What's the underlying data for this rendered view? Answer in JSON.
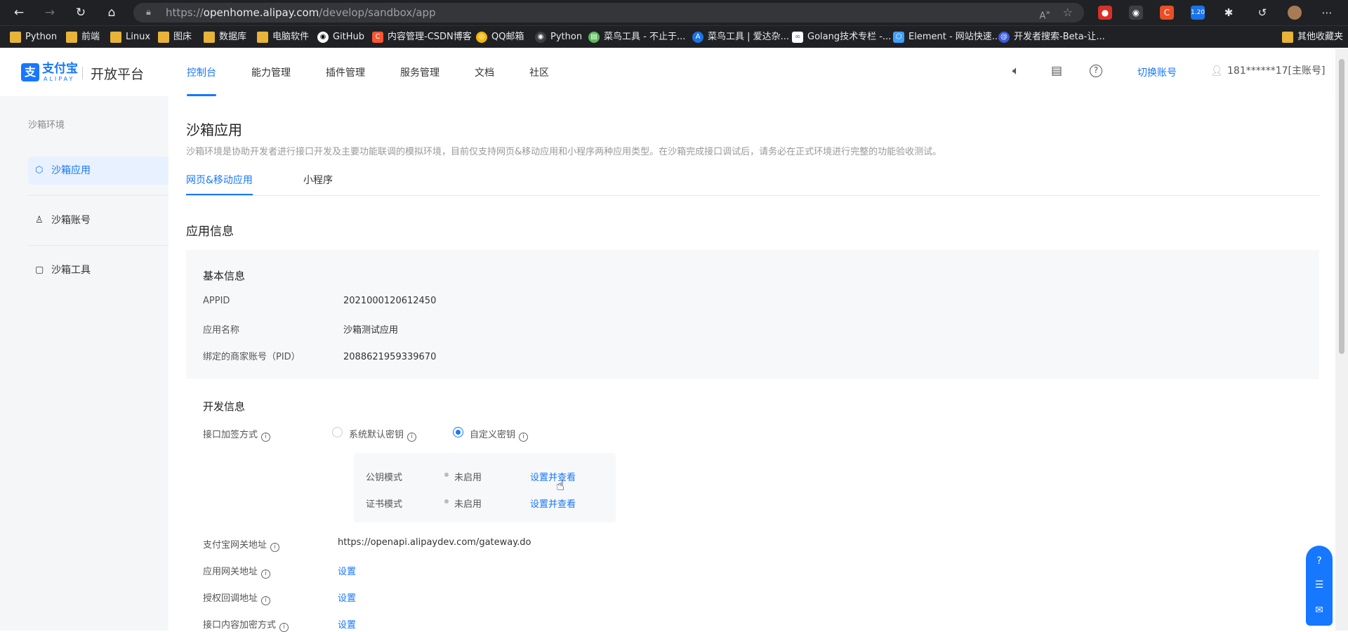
{
  "browser": {
    "url_host": "openhome.alipay.com",
    "url_prefix": "https://",
    "url_path": "/develop/sandbox/app",
    "other_bookmarks": "其他收藏夹",
    "extension_badge": "1.20",
    "bookmarks": [
      {
        "label": "Python",
        "icon": "folder-icon"
      },
      {
        "label": "前端",
        "icon": "folder-icon"
      },
      {
        "label": "Linux",
        "icon": "folder-icon"
      },
      {
        "label": "图床",
        "icon": "folder-icon"
      },
      {
        "label": "数据库",
        "icon": "folder-icon"
      },
      {
        "label": "电脑软件",
        "icon": "folder-icon"
      },
      {
        "label": "GitHub",
        "icon": "github-icon"
      },
      {
        "label": "内容管理-CSDN博客",
        "icon": "csdn-icon"
      },
      {
        "label": "QQ邮箱",
        "icon": "qq-mail-icon"
      },
      {
        "label": "Python",
        "icon": "python-icon"
      },
      {
        "label": "菜鸟工具 - 不止于...",
        "icon": "runoob-icon"
      },
      {
        "label": "菜鸟工具 | 爱达杂...",
        "icon": "aida-icon"
      },
      {
        "label": "Golang技术专栏 -...",
        "icon": "golang-icon"
      },
      {
        "label": "Element - 网站快速...",
        "icon": "element-icon"
      },
      {
        "label": "开发者搜索-Beta-让...",
        "icon": "dev-search-icon"
      }
    ]
  },
  "header": {
    "logo_cn": "支付宝",
    "logo_en": "ALIPAY",
    "platform": "开放平台",
    "nav": [
      "控制台",
      "能力管理",
      "插件管理",
      "服务管理",
      "文档",
      "社区"
    ],
    "switch_account": "切换账号",
    "user": "181******17[主账号]"
  },
  "sidebar": {
    "title": "沙箱环境",
    "items": [
      "沙箱应用",
      "沙箱账号",
      "沙箱工具"
    ]
  },
  "page": {
    "title": "沙箱应用",
    "desc": "沙箱环境是协助开发者进行接口开发及主要功能联调的模拟环境，目前仅支持网页&移动应用和小程序两种应用类型。在沙箱完成接口调试后，请务必在正式环境进行完整的功能验收测试。",
    "tabs": [
      "网页&移动应用",
      "小程序"
    ],
    "section_title": "应用信息",
    "basic": {
      "title": "基本信息",
      "appid_label": "APPID",
      "appid": "2021000120612450",
      "name_label": "应用名称",
      "name": "沙箱测试应用",
      "pid_label": "绑定的商家账号（PID）",
      "pid": "2088621959339670"
    },
    "dev": {
      "title": "开发信息",
      "sign_label": "接口加签方式",
      "opt_default": "系统默认密钥",
      "opt_custom": "自定义密钥",
      "pubkey_label": "公钥模式",
      "pubkey_status": "未启用",
      "pubkey_action": "设置并查看",
      "cert_label": "证书模式",
      "cert_status": "未启用",
      "cert_action": "设置并查看",
      "gateway_label": "支付宝网关地址",
      "gateway": "https://openapi.alipaydev.com/gateway.do",
      "app_gateway_label": "应用网关地址",
      "app_gateway_action": "设置",
      "callback_label": "授权回调地址",
      "callback_action": "设置",
      "encrypt_label": "接口内容加密方式",
      "encrypt_action": "设置"
    }
  }
}
